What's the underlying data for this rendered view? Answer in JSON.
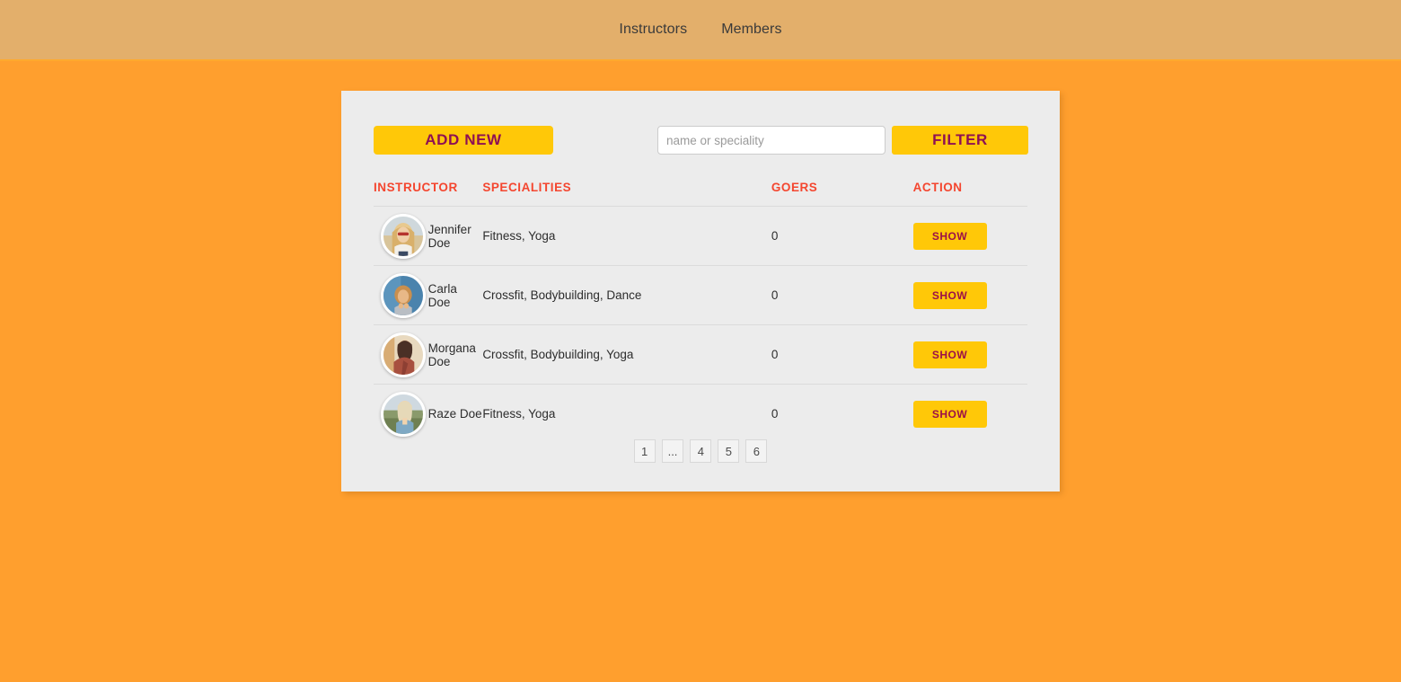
{
  "nav": {
    "links": [
      {
        "label": "Instructors",
        "name": "nav-link-instructors"
      },
      {
        "label": "Members",
        "name": "nav-link-members"
      }
    ]
  },
  "toolbar": {
    "add_new_label": "ADD NEW",
    "search_placeholder": "name or speciality",
    "search_value": "",
    "filter_label": "FILTER"
  },
  "table": {
    "headers": [
      "INSTRUCTOR",
      "SPECIALITIES",
      "GOERS",
      "ACTION"
    ],
    "action_label": "SHOW",
    "rows": [
      {
        "name": "Jennifer Doe",
        "specialities": "Fitness, Yoga",
        "goers": "0",
        "action": "SHOW",
        "avatar": "portrait-blonde-sunglasses"
      },
      {
        "name": "Carla Doe",
        "specialities": "Crossfit, Bodybuilding, Dance",
        "goers": "0",
        "action": "SHOW",
        "avatar": "portrait-curly-blue-background"
      },
      {
        "name": "Morgana Doe",
        "specialities": "Crossfit, Bodybuilding, Yoga",
        "goers": "0",
        "action": "SHOW",
        "avatar": "portrait-red-dress"
      },
      {
        "name": "Raze Doe",
        "specialities": "Fitness, Yoga",
        "goers": "0",
        "action": "SHOW",
        "avatar": "portrait-outdoor-landscape"
      }
    ]
  },
  "pagination": {
    "items": [
      "1",
      "...",
      "4",
      "5",
      "6"
    ]
  },
  "colors": {
    "page_background": "#FF9F2E",
    "navbar_background": "#E3AF6B",
    "card_background": "#ECECEC",
    "accent_button": "#FFC808",
    "button_text": "#8E1054",
    "table_header_text": "#F4462F"
  }
}
